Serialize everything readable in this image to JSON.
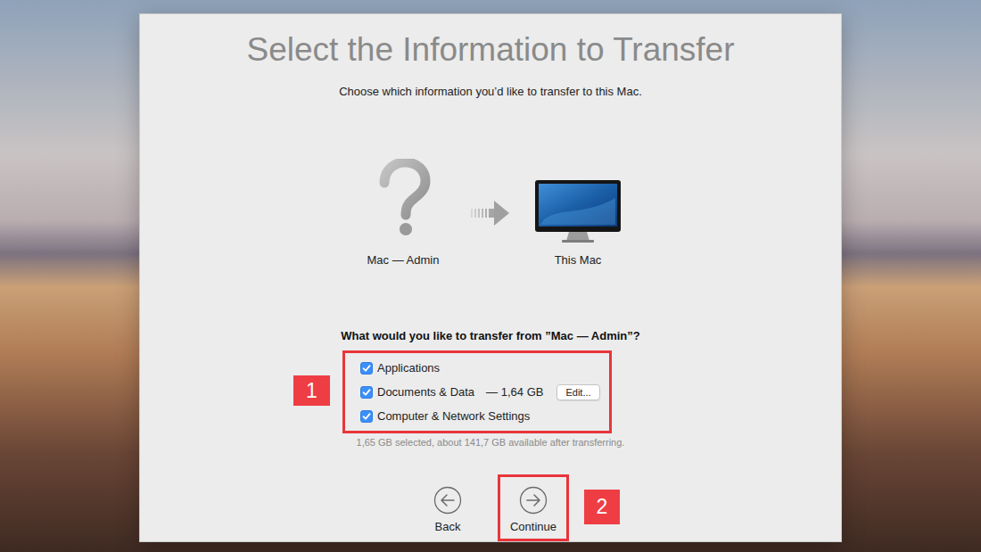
{
  "dialog": {
    "title": "Select the Information to Transfer",
    "subtitle": "Choose which information you’d like to transfer to this Mac."
  },
  "transfer": {
    "source": "Mac — Admin",
    "target": "This Mac"
  },
  "question": "What would you like to transfer from ”Mac — Admin”?",
  "options": {
    "highlighted": true,
    "badge": "1",
    "items": [
      {
        "label": "Applications",
        "checked": true
      },
      {
        "label": "Documents & Data",
        "size": "— 1,64 GB",
        "button": "Edit...",
        "checked": true
      },
      {
        "label": "Computer & Network Settings",
        "checked": true
      }
    ]
  },
  "summary": "1,65 GB selected, about 141,7 GB available after transferring.",
  "buttons": [
    {
      "label": "Back",
      "highlighted": false
    },
    {
      "label": "Continue",
      "highlighted": true,
      "badge": "2"
    }
  ]
}
